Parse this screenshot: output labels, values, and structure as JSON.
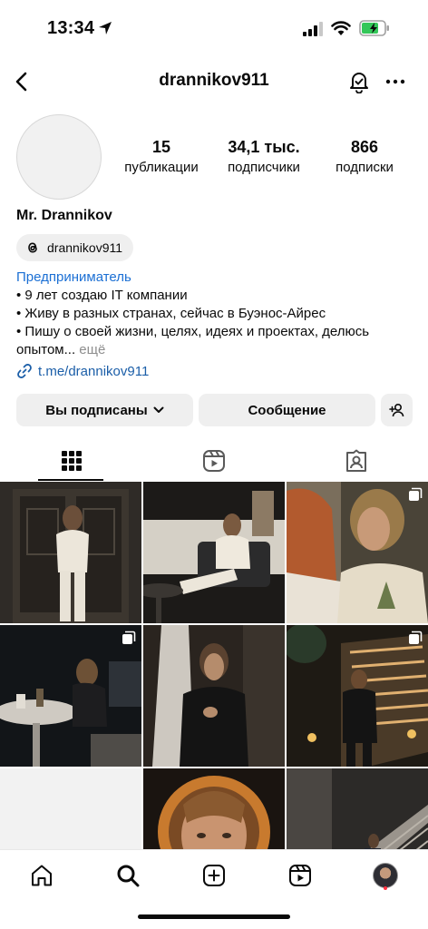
{
  "status_bar": {
    "time": "13:34",
    "battery_color": "#34c759"
  },
  "header": {
    "username": "drannikov911"
  },
  "stats": [
    {
      "number": "15",
      "label": "публикации"
    },
    {
      "number": "34,1 тыс.",
      "label": "подписчики"
    },
    {
      "number": "866",
      "label": "подписки"
    }
  ],
  "profile": {
    "display_name": "Mr. Drannikov",
    "threads_handle": "drannikov911",
    "category": "Предприниматель",
    "bio_lines": [
      "• 9 лет создаю IT компании",
      "• Живу в разных странах, сейчас в Буэнос-Айрес",
      "• Пишу о своей жизни, целях, идеях и проектах, делюсь",
      "опытом..."
    ],
    "more_label": "ещё",
    "link": "t.me/drannikov911"
  },
  "actions": {
    "following_label": "Вы подписаны",
    "message_label": "Сообщение"
  },
  "tabs": [
    {
      "name": "posts-grid",
      "icon": "grid-icon",
      "active": true
    },
    {
      "name": "reels",
      "icon": "reels-icon",
      "active": false
    },
    {
      "name": "tagged",
      "icon": "tagged-icon",
      "active": false
    }
  ],
  "posts": [
    {
      "alt": "man in white outfit standing at ornate dark door",
      "multi": false
    },
    {
      "alt": "man in white suit sitting in armchair",
      "multi": false
    },
    {
      "alt": "man and red-haired woman, palm print shirt",
      "multi": true
    },
    {
      "alt": "night terrace with table and man",
      "multi": true
    },
    {
      "alt": "man in black shirt, hand on chest",
      "multi": false
    },
    {
      "alt": "man in black on lit steps at night",
      "multi": true
    },
    {
      "alt": "empty",
      "multi": false
    },
    {
      "alt": "portrait of man with halo light",
      "multi": false
    },
    {
      "alt": "man walking on stairs at night",
      "multi": false
    }
  ],
  "bottom_nav": [
    "home-icon",
    "search-icon",
    "create-icon",
    "reels-icon",
    "profile-avatar"
  ],
  "colors": {
    "link": "#1b6fd4",
    "button_bg": "#efefef",
    "notification_dot": "#ff3040"
  }
}
